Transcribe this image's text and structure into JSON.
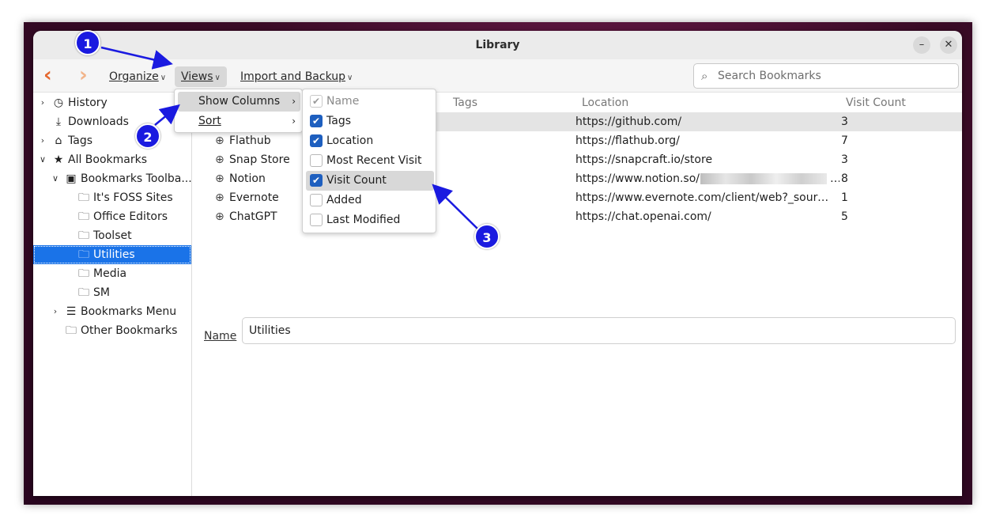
{
  "window": {
    "title": "Library"
  },
  "toolbar": {
    "organize": "Organize",
    "views": "Views",
    "import_backup": "Import and Backup",
    "search_placeholder": "Search Bookmarks"
  },
  "sidebar": {
    "history": "History",
    "downloads": "Downloads",
    "tags": "Tags",
    "all_bookmarks": "All Bookmarks",
    "bookmarks_toolbar": "Bookmarks Toolba...",
    "folders": [
      "It's FOSS Sites",
      "Office Editors",
      "Toolset",
      "Utilities",
      "Media",
      "SM"
    ],
    "bookmarks_menu": "Bookmarks Menu",
    "other_bookmarks": "Other Bookmarks"
  },
  "columns": {
    "tags": "Tags",
    "location": "Location",
    "visit_count": "Visit Count"
  },
  "rows": [
    {
      "name": "",
      "location": "https://github.com/",
      "visits": "3"
    },
    {
      "name": "Flathub",
      "location": "https://flathub.org/",
      "visits": "7"
    },
    {
      "name": "Snap Store",
      "location": "https://snapcraft.io/store",
      "visits": "3"
    },
    {
      "name": "Notion",
      "location": "https://www.notion.so/",
      "visits": "8"
    },
    {
      "name": "Evernote",
      "location": "https://www.evernote.com/client/web?_source…",
      "visits": "1"
    },
    {
      "name": "ChatGPT",
      "location": "https://chat.openai.com/",
      "visits": "5"
    }
  ],
  "details": {
    "name_label": "Name",
    "name_value": "Utilities"
  },
  "views_menu": {
    "show_columns": "Show Columns",
    "sort": "Sort"
  },
  "columns_menu": [
    {
      "label": "Name",
      "checked": true,
      "disabled": true
    },
    {
      "label": "Tags",
      "checked": true
    },
    {
      "label": "Location",
      "checked": true
    },
    {
      "label": "Most Recent Visit",
      "checked": false
    },
    {
      "label": "Visit Count",
      "checked": true
    },
    {
      "label": "Added",
      "checked": false
    },
    {
      "label": "Last Modified",
      "checked": false
    }
  ],
  "annotations": [
    "1",
    "2",
    "3"
  ],
  "colors": {
    "accent": "#1a73e8",
    "checkbox": "#1e5fbf",
    "annotation": "#1a1ae0"
  }
}
